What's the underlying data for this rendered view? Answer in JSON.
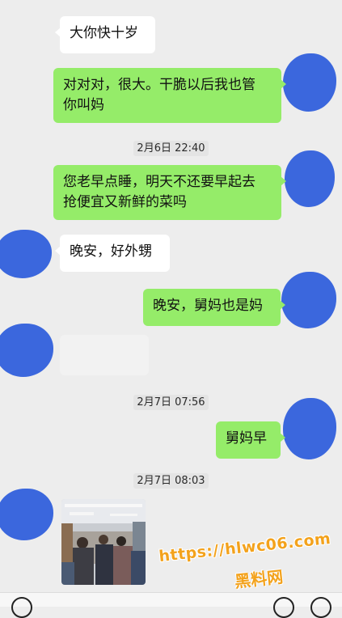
{
  "messages": [
    {
      "side": "left",
      "type": "text",
      "text": "大你快十岁"
    },
    {
      "side": "right",
      "type": "text",
      "text": "对对对，很大。干脆以后我也管\n你叫妈"
    },
    {
      "type": "timestamp",
      "text": "2月6日 22:40"
    },
    {
      "side": "right",
      "type": "text",
      "text": "您老早点睡，明天不还要早起去\n抢便宜又新鲜的菜吗"
    },
    {
      "side": "left",
      "type": "text",
      "text": "晚安，好外甥"
    },
    {
      "side": "right",
      "type": "text",
      "text": "晚安，舅妈也是妈"
    },
    {
      "side": "left",
      "type": "blank"
    },
    {
      "type": "timestamp",
      "text": "2月7日 07:56"
    },
    {
      "side": "right",
      "type": "text",
      "text": "舅妈早"
    },
    {
      "type": "timestamp",
      "text": "2月7日 08:03"
    },
    {
      "side": "left",
      "type": "image",
      "description": "supermarket-crowd-photo"
    }
  ],
  "watermark": {
    "line1": "https://hlwc06.com",
    "line2": "黑料网",
    "color": "#f3a21c"
  },
  "colors": {
    "background": "#ededed",
    "bubble_sent": "#95ec69",
    "bubble_received": "#ffffff",
    "avatar_redaction": "#3b67dd"
  },
  "input_bar": {
    "icons": [
      "voice-icon",
      "emoji-icon",
      "plus-icon"
    ]
  }
}
